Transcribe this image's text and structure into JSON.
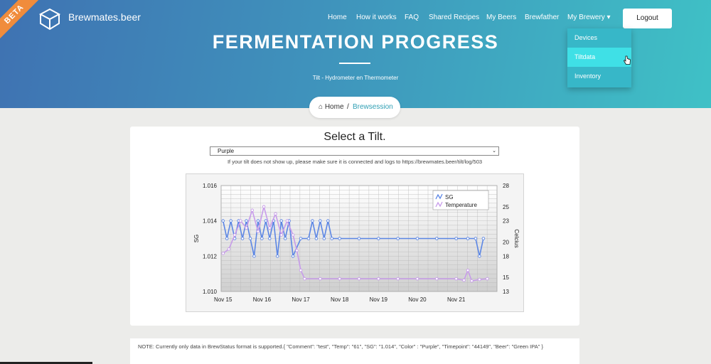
{
  "header": {
    "beta_label": "BETA",
    "brand": "Brewmates.beer",
    "nav": [
      {
        "label": "Home"
      },
      {
        "label": "How it works"
      },
      {
        "label": "FAQ"
      },
      {
        "label": "Shared Recipes"
      },
      {
        "label": "My Beers"
      },
      {
        "label": "Brewfather"
      },
      {
        "label": "My Brewery ▾"
      }
    ],
    "logout": "Logout",
    "dropdown": [
      {
        "label": "Devices"
      },
      {
        "label": "Tiltdata"
      },
      {
        "label": "Inventory"
      }
    ],
    "dropdown_active": "Tiltdata"
  },
  "hero": {
    "title": "FERMENTATION PROGRESS",
    "subtitle": "Tilt - Hydrometer en Thermometer"
  },
  "breadcrumb": {
    "home": "Home",
    "separator": "/",
    "current": "Brewsession"
  },
  "card": {
    "title": "Select a Tilt.",
    "select_value": "Purple",
    "hint": "If your tilt does not show up, please make sure it is connected and logs to https://brewmates.beer/tilt/log/503"
  },
  "chart_data": {
    "type": "line",
    "x": [
      "Nov 15",
      "Nov 16",
      "Nov 17",
      "Nov 18",
      "Nov 19",
      "Nov 20",
      "Nov 21"
    ],
    "ylabel": "SG",
    "y2label": "Celcius",
    "ylim": [
      1.01,
      1.016
    ],
    "y2lim": [
      13,
      28
    ],
    "yticks": [
      "1.010",
      "1.012",
      "1.014",
      "1.016"
    ],
    "y2ticks": [
      "13",
      "15",
      "18",
      "20",
      "23",
      "25",
      "28"
    ],
    "grid": true,
    "legend_position": "top-right",
    "series": [
      {
        "name": "SG",
        "color": "#5b86e5",
        "axis": "left",
        "points": [
          [
            0.0,
            1.014
          ],
          [
            0.1,
            1.013
          ],
          [
            0.2,
            1.014
          ],
          [
            0.3,
            1.013
          ],
          [
            0.4,
            1.014
          ],
          [
            0.5,
            1.013
          ],
          [
            0.6,
            1.014
          ],
          [
            0.7,
            1.013
          ],
          [
            0.8,
            1.012
          ],
          [
            0.9,
            1.014
          ],
          [
            1.0,
            1.013
          ],
          [
            1.1,
            1.014
          ],
          [
            1.2,
            1.013
          ],
          [
            1.3,
            1.014
          ],
          [
            1.4,
            1.012
          ],
          [
            1.5,
            1.014
          ],
          [
            1.6,
            1.013
          ],
          [
            1.7,
            1.014
          ],
          [
            1.8,
            1.012
          ],
          [
            2.0,
            1.013
          ],
          [
            2.2,
            1.013
          ],
          [
            2.3,
            1.014
          ],
          [
            2.4,
            1.013
          ],
          [
            2.5,
            1.014
          ],
          [
            2.6,
            1.013
          ],
          [
            2.7,
            1.014
          ],
          [
            2.8,
            1.013
          ],
          [
            3.0,
            1.013
          ],
          [
            3.5,
            1.013
          ],
          [
            4.0,
            1.013
          ],
          [
            4.5,
            1.013
          ],
          [
            5.0,
            1.013
          ],
          [
            5.5,
            1.013
          ],
          [
            6.0,
            1.013
          ],
          [
            6.3,
            1.013
          ],
          [
            6.5,
            1.013
          ],
          [
            6.6,
            1.012
          ],
          [
            6.7,
            1.013
          ]
        ]
      },
      {
        "name": "Temperature",
        "color": "#c79bea",
        "axis": "right",
        "points": [
          [
            0.0,
            18.4
          ],
          [
            0.15,
            19.0
          ],
          [
            0.3,
            21.0
          ],
          [
            0.45,
            23.0
          ],
          [
            0.6,
            22.0
          ],
          [
            0.75,
            24.5
          ],
          [
            0.9,
            21.5
          ],
          [
            1.05,
            25.0
          ],
          [
            1.2,
            22.0
          ],
          [
            1.35,
            24.0
          ],
          [
            1.5,
            21.0
          ],
          [
            1.65,
            23.0
          ],
          [
            1.8,
            21.0
          ],
          [
            1.9,
            18.8
          ],
          [
            2.0,
            16.0
          ],
          [
            2.1,
            14.8
          ],
          [
            2.5,
            14.8
          ],
          [
            3.0,
            14.8
          ],
          [
            3.5,
            14.8
          ],
          [
            4.0,
            14.8
          ],
          [
            4.5,
            14.8
          ],
          [
            5.0,
            14.8
          ],
          [
            5.5,
            14.8
          ],
          [
            6.0,
            14.8
          ],
          [
            6.2,
            14.6
          ],
          [
            6.3,
            16.0
          ],
          [
            6.4,
            14.5
          ],
          [
            6.6,
            14.7
          ],
          [
            6.8,
            14.8
          ]
        ]
      }
    ]
  },
  "note": {
    "text": "NOTE: Currently only data in BrewStatus format is supported.{ \"Comment\": \"test\", \"Temp\": \"61\", \"SG\": \"1.014\", \"Color\" : \"Purple\", \"Timepoint\": \"44149\", \"Beer\": \"Green IPA\" }"
  }
}
